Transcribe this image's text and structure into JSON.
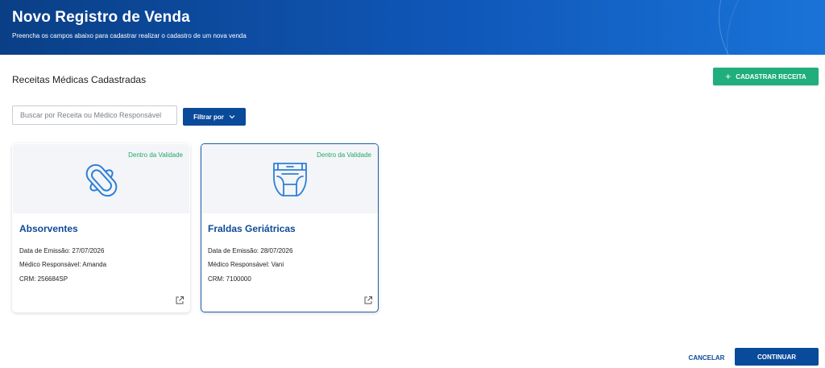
{
  "header": {
    "title": "Novo Registro de Venda",
    "subtitle": "Preencha os campos abaixo para cadastrar realizar o cadastro de um nova venda"
  },
  "section": {
    "title": "Receitas Médicas Cadastradas",
    "register_button": "CADASTRAR RECEITA"
  },
  "search": {
    "placeholder": "Buscar por Receita ou Médico Responsável",
    "value": ""
  },
  "filter": {
    "label": "Filtrar por"
  },
  "cards": [
    {
      "badge": "Dentro da Validade",
      "name": "Absorventes",
      "date": "Data de Emissão: 27/07/2026",
      "doctor": "Médico Responsável: Amanda",
      "crm": "CRM: 256684SP",
      "icon": "sanitary-pad-icon"
    },
    {
      "badge": "Dentro da Validade",
      "name": "Fraldas Geriátricas",
      "date": "Data de Emissão: 28/07/2026",
      "doctor": "Médico Responsável: Vani",
      "crm": "CRM: 7100000",
      "icon": "diaper-icon"
    }
  ],
  "footer": {
    "cancel": "CANCELAR",
    "continue": "CONTINUAR"
  },
  "colors": {
    "primary": "#0a4a9a",
    "accent_green": "#1fae7c",
    "badge_green": "#22a866",
    "header_gradient_start": "#0a3f86",
    "header_gradient_end": "#1a73d8"
  }
}
